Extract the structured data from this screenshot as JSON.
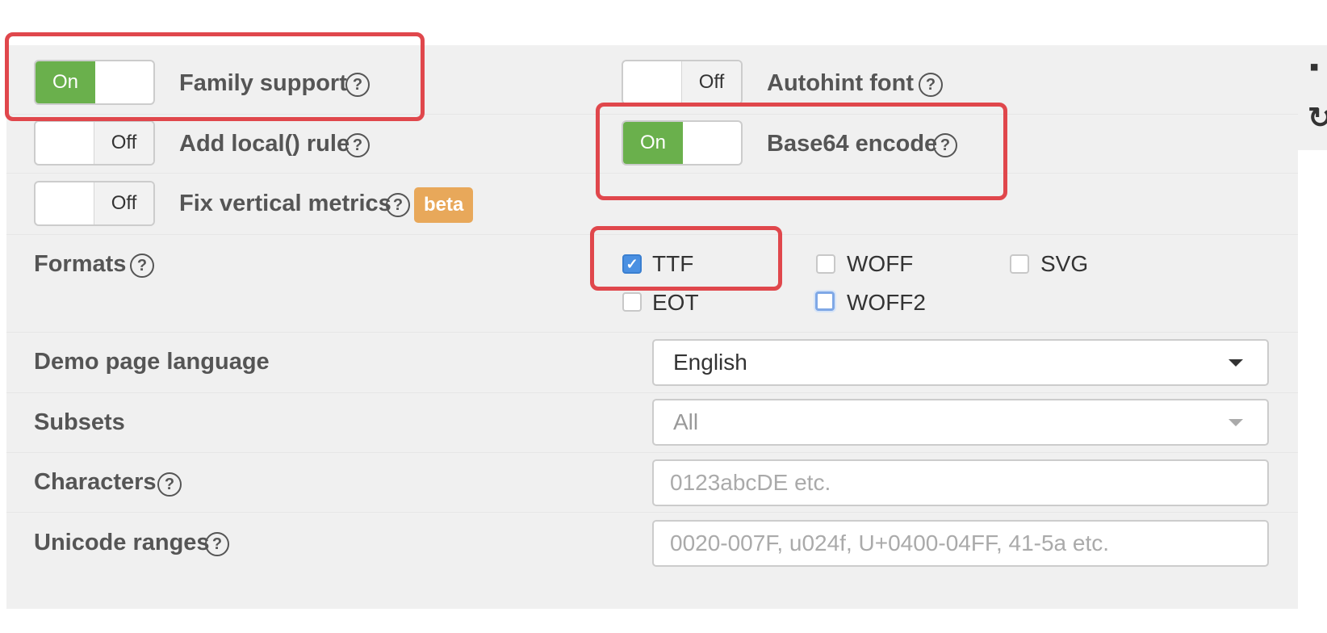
{
  "toggles": {
    "family_support": {
      "label": "Family support",
      "state": "On"
    },
    "autohint_font": {
      "label": "Autohint font",
      "state": "Off"
    },
    "add_local_rule": {
      "label": "Add local() rule",
      "state": "Off"
    },
    "base64_encode": {
      "label": "Base64 encode",
      "state": "On"
    },
    "fix_vertical_metrics": {
      "label": "Fix vertical metrics",
      "state": "Off",
      "badge": "beta"
    }
  },
  "help_glyph": "?",
  "formats": {
    "label": "Formats",
    "options": [
      {
        "label": "TTF",
        "checked": true
      },
      {
        "label": "WOFF",
        "checked": false
      },
      {
        "label": "SVG",
        "checked": false
      },
      {
        "label": "EOT",
        "checked": false
      },
      {
        "label": "WOFF2",
        "checked": false,
        "focused": true
      }
    ]
  },
  "demo_language": {
    "label": "Demo page language",
    "value": "English"
  },
  "subsets": {
    "label": "Subsets",
    "value": "All"
  },
  "characters": {
    "label": "Characters",
    "placeholder": "0123abcDE etc."
  },
  "unicode_ranges": {
    "label": "Unicode ranges",
    "placeholder": "0020-007F, u024f, U+0400-04FF, 41-5a etc."
  },
  "check_glyph": "✓",
  "colors": {
    "accent_green": "#6ab04c",
    "highlight_red": "#e0474c",
    "checkbox_blue": "#4a90e2",
    "badge_orange": "#e8a85a"
  },
  "side_icons": [
    "save-icon",
    "refresh-icon"
  ]
}
